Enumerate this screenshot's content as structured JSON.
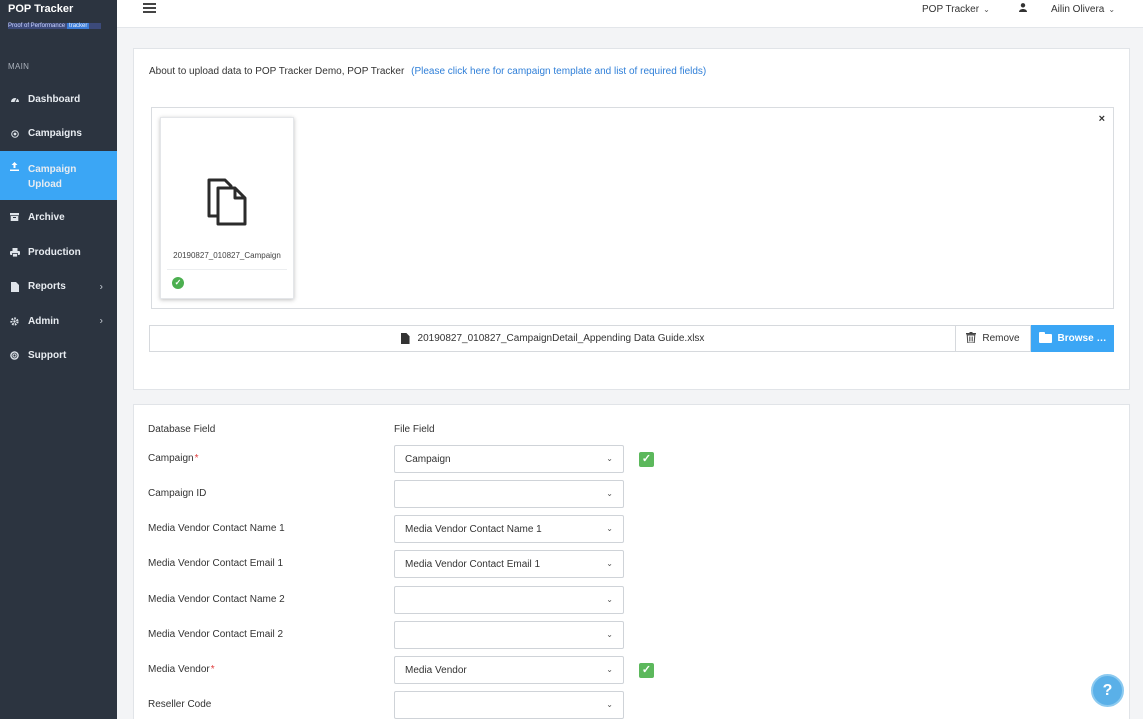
{
  "app": {
    "title": "POP Tracker",
    "subtitle": "Proof of Performance",
    "subtitle_badge": "tracker"
  },
  "sidebar": {
    "section_label": "MAIN",
    "items": [
      {
        "label": "Dashboard",
        "icon": "dashboard-icon"
      },
      {
        "label": "Campaigns",
        "icon": "campaigns-icon"
      },
      {
        "label": "Campaign Upload",
        "icon": "upload-icon",
        "active": true
      },
      {
        "label": "Archive",
        "icon": "archive-icon"
      },
      {
        "label": "Production",
        "icon": "production-icon"
      },
      {
        "label": "Reports",
        "icon": "reports-icon",
        "has_chevron": true
      },
      {
        "label": "Admin",
        "icon": "admin-icon",
        "has_chevron": true
      },
      {
        "label": "Support",
        "icon": "support-icon"
      }
    ],
    "chevron": "›"
  },
  "topbar": {
    "tracker_menu": "POP Tracker",
    "user_name": "Ailin Olivera",
    "caret": "⌄"
  },
  "upload": {
    "message": "About to upload data to POP Tracker Demo, POP Tracker",
    "template_link": "(Please click here for campaign template and list of required fields)",
    "close_symbol": "×",
    "file_thumbnail_caption": "20190827_010827_Campaign",
    "file_status": "✓",
    "file_name": "20190827_010827_CampaignDetail_Appending Data Guide.xlsx",
    "remove_label": "Remove",
    "browse_label": "Browse …"
  },
  "mapping": {
    "db_field_header": "Database Field",
    "file_field_header": "File Field",
    "chevron": "⌄",
    "rows": [
      {
        "field": "Campaign",
        "required": true,
        "value": "Campaign",
        "matched": true
      },
      {
        "field": "Campaign ID",
        "required": false,
        "value": "",
        "matched": false
      },
      {
        "field": "Media Vendor Contact Name 1",
        "required": false,
        "value": "Media Vendor Contact Name 1",
        "matched": false
      },
      {
        "field": "Media Vendor Contact Email 1",
        "required": false,
        "value": "Media Vendor Contact Email 1",
        "matched": false
      },
      {
        "field": "Media Vendor Contact Name 2",
        "required": false,
        "value": "",
        "matched": false
      },
      {
        "field": "Media Vendor Contact Email 2",
        "required": false,
        "value": "",
        "matched": false
      },
      {
        "field": "Media Vendor",
        "required": true,
        "value": "Media Vendor",
        "matched": true
      },
      {
        "field": "Reseller Code",
        "required": false,
        "value": "",
        "matched": false
      }
    ],
    "required_mark": "*",
    "check_symbol": "✓"
  },
  "help": {
    "label": "?"
  },
  "colors": {
    "sidebar_bg": "#2c3440",
    "accent": "#3ba6f5",
    "link": "#2f7fd8",
    "success": "#5cb85c",
    "required": "#e03b3b"
  }
}
